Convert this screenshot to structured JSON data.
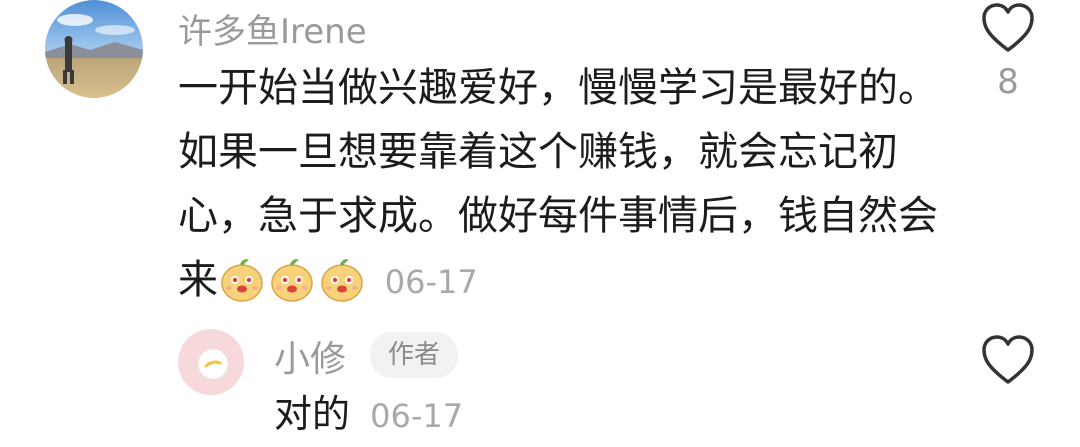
{
  "comments": [
    {
      "username": "许多鱼Irene",
      "lines": [
        "一开始当做兴趣爱好，慢慢学习是最好的。",
        "如果一旦想要靠着这个赚钱，就会忘记初",
        "心，急于求成。做好每件事情后，钱自然会",
        "来"
      ],
      "emoji_count": 3,
      "emoji_name": "doge-emoji",
      "date": "06-17",
      "likes": "8",
      "like_icon": "heart-outline-icon"
    },
    {
      "username": "小修",
      "badge": "作者",
      "text": "对的",
      "date": "06-17",
      "like_icon": "heart-outline-icon"
    }
  ],
  "colors": {
    "username": "#9a9a9a",
    "text": "#1c1c1c",
    "date": "#a9a9a9",
    "badge_bg": "#f2f2f2"
  }
}
